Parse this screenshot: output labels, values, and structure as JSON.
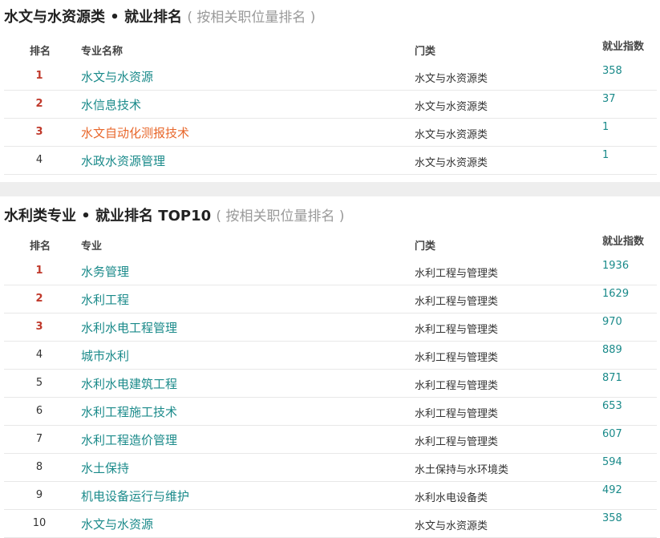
{
  "section1": {
    "title": "水文与水资源类 • 就业排名",
    "subtitle": "( 按相关职位量排名 )",
    "headers": {
      "rank": "排名",
      "name": "专业名称",
      "category": "门类",
      "index": "就业指数"
    },
    "rows": [
      {
        "rank": "1",
        "name": "水文与水资源",
        "category": "水文与水资源类",
        "index": "358"
      },
      {
        "rank": "2",
        "name": "水信息技术",
        "category": "水文与水资源类",
        "index": "37"
      },
      {
        "rank": "3",
        "name": "水文自动化测报技术",
        "category": "水文与水资源类",
        "index": "1"
      },
      {
        "rank": "4",
        "name": "水政水资源管理",
        "category": "水文与水资源类",
        "index": "1"
      }
    ]
  },
  "section2": {
    "title": "水利类专业 • 就业排名 TOP10",
    "subtitle": "( 按相关职位量排名 )",
    "headers": {
      "rank": "排名",
      "name": "专业",
      "category": "门类",
      "index": "就业指数"
    },
    "rows": [
      {
        "rank": "1",
        "name": "水务管理",
        "category": "水利工程与管理类",
        "index": "1936"
      },
      {
        "rank": "2",
        "name": "水利工程",
        "category": "水利工程与管理类",
        "index": "1629"
      },
      {
        "rank": "3",
        "name": "水利水电工程管理",
        "category": "水利工程与管理类",
        "index": "970"
      },
      {
        "rank": "4",
        "name": "城市水利",
        "category": "水利工程与管理类",
        "index": "889"
      },
      {
        "rank": "5",
        "name": "水利水电建筑工程",
        "category": "水利工程与管理类",
        "index": "871"
      },
      {
        "rank": "6",
        "name": "水利工程施工技术",
        "category": "水利工程与管理类",
        "index": "653"
      },
      {
        "rank": "7",
        "name": "水利工程造价管理",
        "category": "水利工程与管理类",
        "index": "607"
      },
      {
        "rank": "8",
        "name": "水土保持",
        "category": "水土保持与水环境类",
        "index": "594"
      },
      {
        "rank": "9",
        "name": "机电设备运行与维护",
        "category": "水利水电设备类",
        "index": "492"
      },
      {
        "rank": "10",
        "name": "水文与水资源",
        "category": "水文与水资源类",
        "index": "358"
      }
    ]
  },
  "colors": {
    "link": "#1a8a8a",
    "highlight_link": "#e8672b",
    "top_rank": "#c0392b"
  }
}
